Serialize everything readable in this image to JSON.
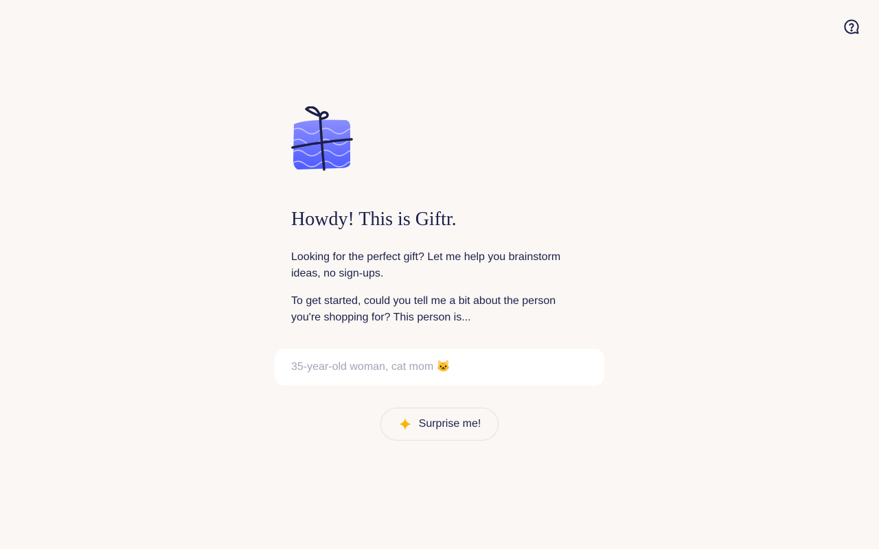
{
  "header": {
    "help_icon": "chat-question-icon"
  },
  "hero": {
    "illustration": "gift-box-icon",
    "title": "Howdy! This is Giftr.",
    "intro": "Looking for the perfect gift? Let me help you brainstorm ideas, no sign-ups.",
    "prompt": "To get started, could you tell me a bit about the person you're shopping for? This person is..."
  },
  "search": {
    "placeholder": "35-year-old woman, cat mom 🐱",
    "value": ""
  },
  "surprise_button": {
    "label": "Surprise me!",
    "icon": "sparkle-icon"
  },
  "colors": {
    "background": "#faf7f4",
    "text": "#1c1f4a",
    "gift": "#6a74ff",
    "sparkle": "#f5b50a"
  }
}
